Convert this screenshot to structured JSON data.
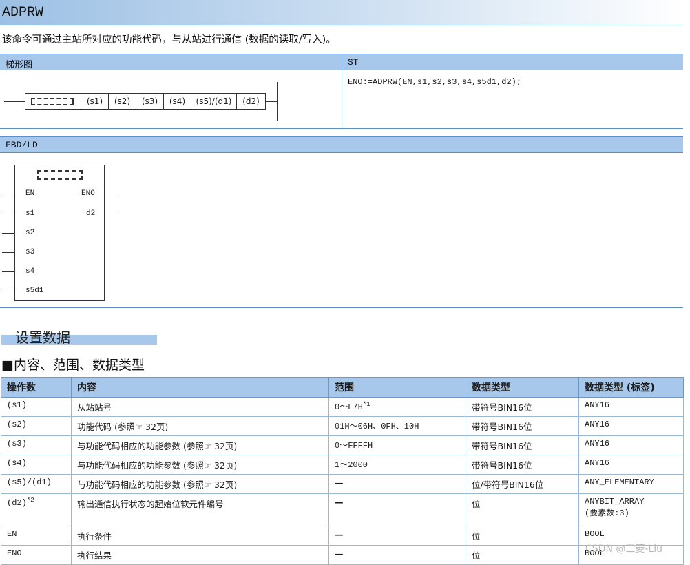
{
  "header": {
    "title": "ADPRW",
    "description": "该命令可通过主站所对应的功能代码，与从站进行通信 (数据的读取/写入)。"
  },
  "ladder": {
    "section_label": "梯形图",
    "operands": [
      "(s1)",
      "(s2)",
      "(s3)",
      "(s4)",
      "(s5)/(d1)",
      "(d2)"
    ]
  },
  "st": {
    "section_label": "ST",
    "code": "ENO:=ADPRW(EN,s1,s2,s3,s4,s5d1,d2);"
  },
  "fbd": {
    "section_label": "FBD/LD",
    "inputs": [
      "EN",
      "s1",
      "s2",
      "s3",
      "s4",
      "s5d1"
    ],
    "outputs": [
      "ENO",
      "d2"
    ]
  },
  "setting": {
    "heading": "设置数据",
    "subheading": "■内容、范围、数据类型"
  },
  "table": {
    "headers": [
      "操作数",
      "内容",
      "范围",
      "数据类型",
      "数据类型 (标签)"
    ],
    "rows": [
      {
        "operand": "(s1)",
        "operand_note": "",
        "content": "从站站号",
        "range": "0～F7H",
        "range_note": "*1",
        "type": "带符号BIN16位",
        "label_type": "ANY16",
        "label_type2": ""
      },
      {
        "operand": "(s2)",
        "operand_note": "",
        "content": "功能代码 (参照☞ 32页)",
        "range": "01H～06H、0FH、10H",
        "range_note": "",
        "type": "带符号BIN16位",
        "label_type": "ANY16",
        "label_type2": ""
      },
      {
        "operand": "(s3)",
        "operand_note": "",
        "content": "与功能代码相应的功能参数 (参照☞ 32页)",
        "range": "0～FFFFH",
        "range_note": "",
        "type": "带符号BIN16位",
        "label_type": "ANY16",
        "label_type2": ""
      },
      {
        "operand": "(s4)",
        "operand_note": "",
        "content": "与功能代码相应的功能参数 (参照☞ 32页)",
        "range": "1～2000",
        "range_note": "",
        "type": "带符号BIN16位",
        "label_type": "ANY16",
        "label_type2": ""
      },
      {
        "operand": "(s5)/(d1)",
        "operand_note": "",
        "content": "与功能代码相应的功能参数 (参照☞ 32页)",
        "range": "—",
        "range_note": "",
        "type": "位/带符号BIN16位",
        "label_type": "ANY_ELEMENTARY",
        "label_type2": ""
      },
      {
        "operand": "(d2)",
        "operand_note": "*2",
        "content": "输出通信执行状态的起始位软元件编号",
        "range": "—",
        "range_note": "",
        "type": "位",
        "label_type": "ANYBIT_ARRAY",
        "label_type2": "(要素数:3)"
      },
      {
        "operand": "EN",
        "operand_note": "",
        "content": "执行条件",
        "range": "—",
        "range_note": "",
        "type": "位",
        "label_type": "BOOL",
        "label_type2": ""
      },
      {
        "operand": "ENO",
        "operand_note": "",
        "content": "执行结果",
        "range": "—",
        "range_note": "",
        "type": "位",
        "label_type": "BOOL",
        "label_type2": ""
      }
    ]
  },
  "watermark": "CSDN @三菱-Liu"
}
